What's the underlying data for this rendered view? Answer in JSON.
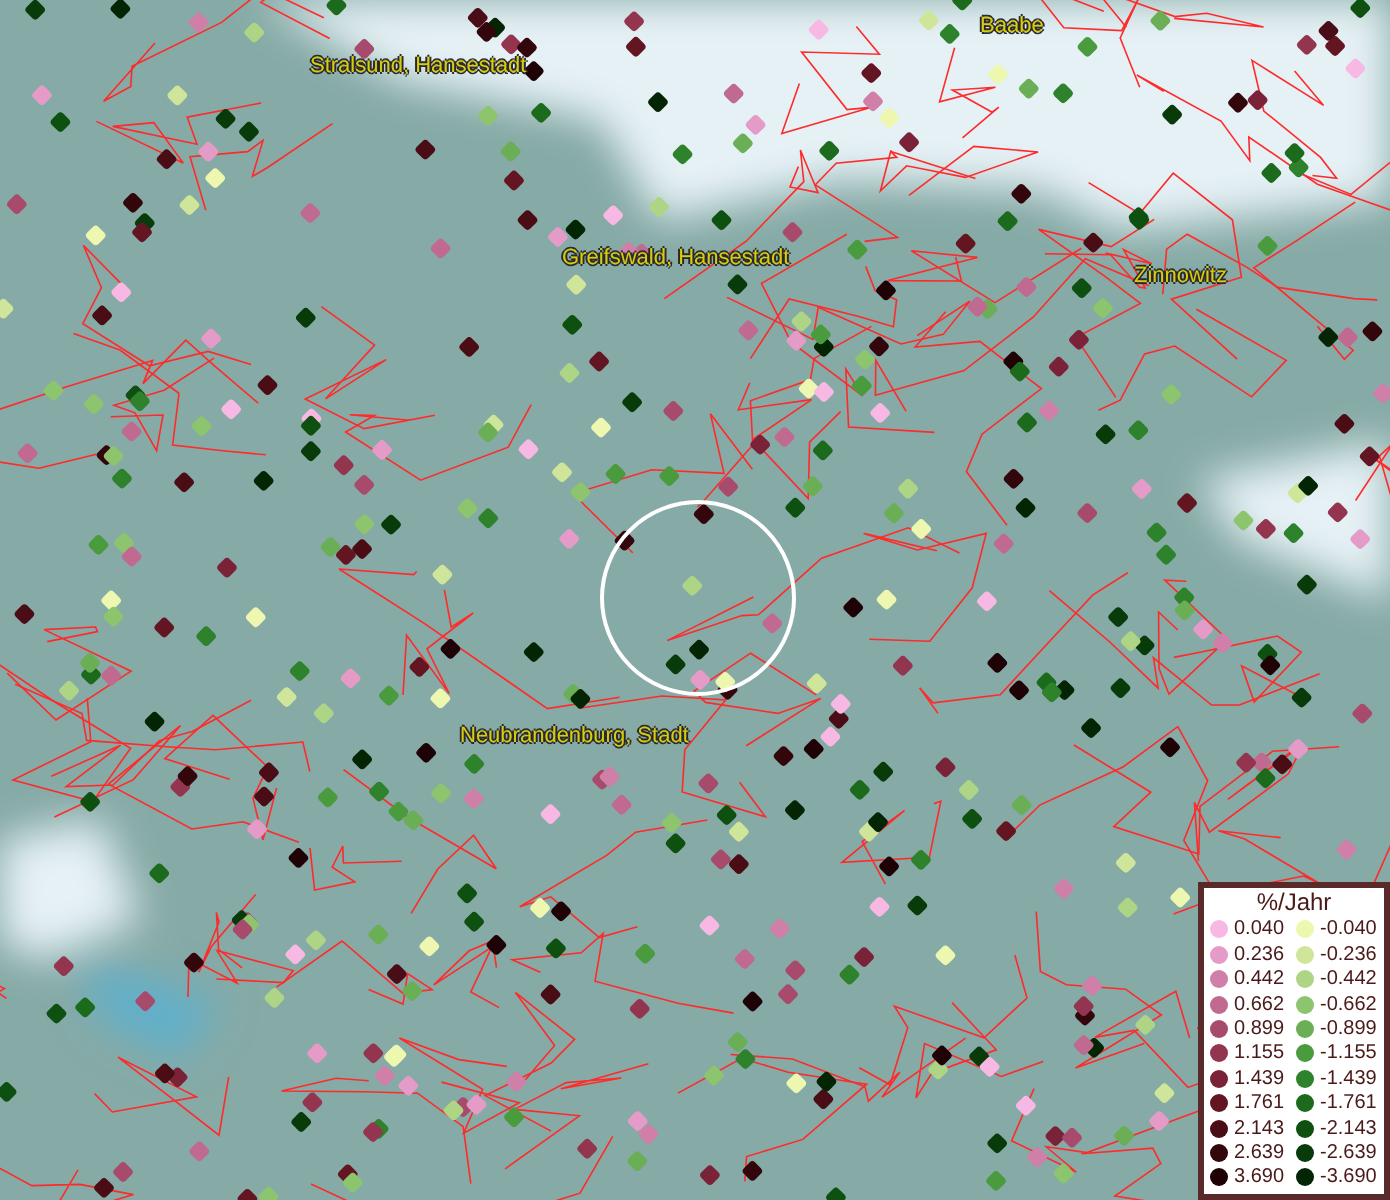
{
  "places": [
    {
      "name": "Baabe"
    },
    {
      "name": "Stralsund, Hansestadt"
    },
    {
      "name": "Greifswald, Hansestadt"
    },
    {
      "name": "Zinnowitz"
    },
    {
      "name": "Neubrandenburg, Stadt"
    }
  ],
  "legend": {
    "title": "%/Jahr",
    "items": [
      {
        "label": "0.040",
        "color": "#f7b8e3"
      },
      {
        "label": "-0.040",
        "color": "#eef7b0"
      },
      {
        "label": "0.236",
        "color": "#e49bc8"
      },
      {
        "label": "-0.236",
        "color": "#cfe69a"
      },
      {
        "label": "0.442",
        "color": "#d07fa8"
      },
      {
        "label": "-0.442",
        "color": "#aed585"
      },
      {
        "label": "0.662",
        "color": "#c06a90"
      },
      {
        "label": "-0.662",
        "color": "#8dc46e"
      },
      {
        "label": "0.899",
        "color": "#a84a6c"
      },
      {
        "label": "-0.899",
        "color": "#6aaf55"
      },
      {
        "label": "1.155",
        "color": "#93354f"
      },
      {
        "label": "-1.155",
        "color": "#4a9a3e"
      },
      {
        "label": "1.439",
        "color": "#7a2338"
      },
      {
        "label": "-1.439",
        "color": "#2e822b"
      },
      {
        "label": "1.761",
        "color": "#641522"
      },
      {
        "label": "-1.761",
        "color": "#1c6a1c"
      },
      {
        "label": "2.143",
        "color": "#4a0c15"
      },
      {
        "label": "-2.143",
        "color": "#0e5010"
      },
      {
        "label": "2.639",
        "color": "#33060c"
      },
      {
        "label": "-2.639",
        "color": "#083a0a"
      },
      {
        "label": "3.690",
        "color": "#1e0206"
      },
      {
        "label": "-3.690",
        "color": "#032503"
      }
    ]
  }
}
